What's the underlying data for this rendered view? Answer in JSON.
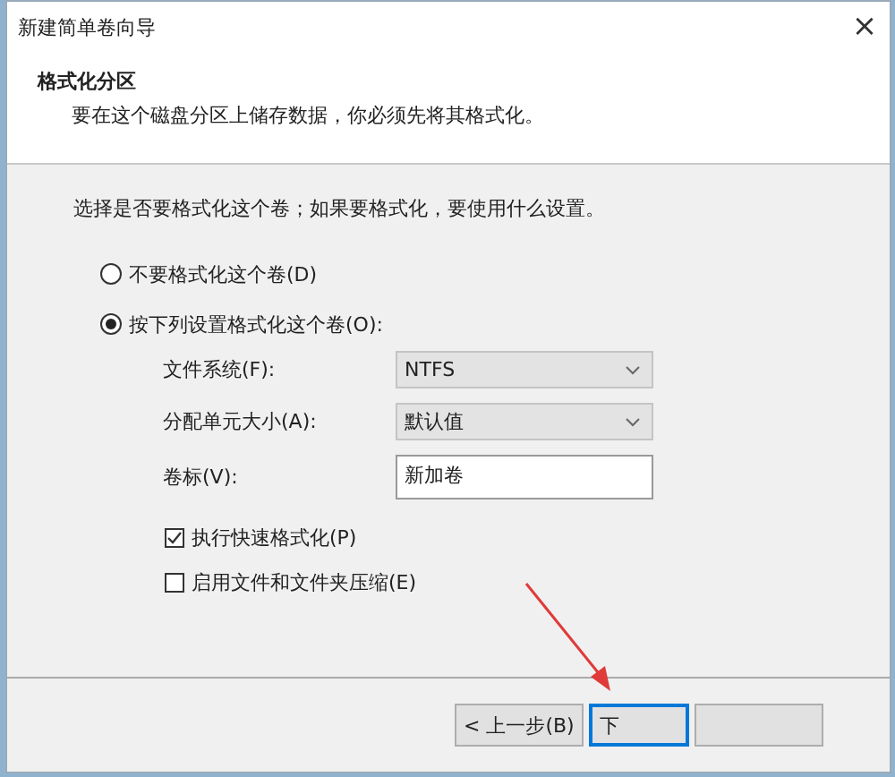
{
  "window": {
    "title": "新建简单卷向导",
    "close": "×"
  },
  "header": {
    "title": "格式化分区",
    "subtitle": "要在这个磁盘分区上储存数据，你必须先将其格式化。"
  },
  "prompt": "选择是否要格式化这个卷；如果要格式化，要使用什么设置。",
  "radios": [
    {
      "label": "不要格式化这个卷(D)",
      "selected": false
    },
    {
      "label": "按下列设置格式化这个卷(O):",
      "selected": true
    }
  ],
  "fields": [
    {
      "kind": "dropdown",
      "label": "文件系统(F):",
      "value": "NTFS"
    },
    {
      "kind": "dropdown",
      "label": "分配单元大小(A):",
      "value": "默认值"
    },
    {
      "kind": "text",
      "label": "卷标(V):",
      "value": "新加卷"
    }
  ],
  "checkboxes": [
    {
      "label": "执行快速格式化(P)",
      "checked": true
    },
    {
      "label": "启用文件和文件夹压缩(E)",
      "checked": false
    }
  ],
  "buttons": [
    {
      "label": "< 上一步(B)",
      "kind": "normal"
    },
    {
      "label": "下",
      "kind": "default"
    },
    {
      "kind": "normal"
    }
  ]
}
